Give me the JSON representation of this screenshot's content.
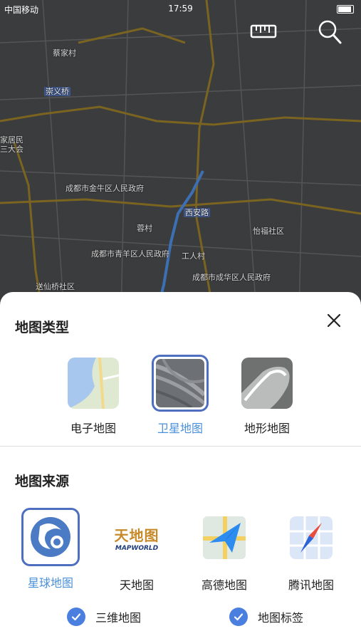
{
  "status": {
    "time": "17:59",
    "carrier": "中国移动"
  },
  "map_labels": [
    "成都市金牛区人民政府",
    "成都市青羊区人民政府",
    "成都市成华区人民政府",
    "怡福社区",
    "工人村",
    "送仙桥社区",
    "崇义桥"
  ],
  "sheet": {
    "map_type_title": "地图类型",
    "map_types": [
      {
        "label": "电子地图",
        "icon": "vector-map-thumb",
        "selected": false
      },
      {
        "label": "卫星地图",
        "icon": "satellite-map-thumb",
        "selected": true
      },
      {
        "label": "地形地图",
        "icon": "terrain-map-thumb",
        "selected": false
      }
    ],
    "map_source_title": "地图来源",
    "map_sources": [
      {
        "label": "星球地图",
        "icon": "planet-map-logo",
        "selected": true
      },
      {
        "label": "天地图",
        "icon": "tianditu-logo",
        "selected": false
      },
      {
        "label": "高德地图",
        "icon": "amap-logo",
        "selected": false
      },
      {
        "label": "腾讯地图",
        "icon": "tencent-map-logo",
        "selected": false
      }
    ],
    "tianditu_logo_text": "天地图",
    "tianditu_logo_sub": "MAPWORLD",
    "options": [
      {
        "label": "三维地图",
        "checked": true
      },
      {
        "label": "地图标签",
        "checked": true
      }
    ]
  },
  "colors": {
    "accent": "#4a90d9",
    "selected_border": "#4e6fc0",
    "check_bg": "#4a7fe0"
  }
}
